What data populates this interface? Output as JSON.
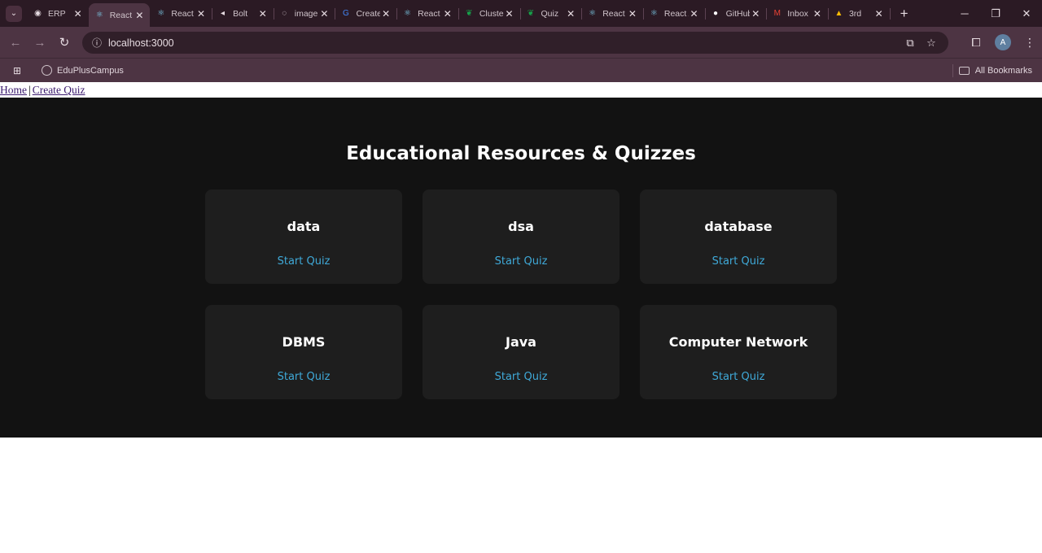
{
  "browser": {
    "tabs": [
      {
        "title": "ERP",
        "icon": "erp-icon"
      },
      {
        "title": "React App",
        "icon": "react-icon",
        "active": true
      },
      {
        "title": "React App",
        "icon": "react-icon"
      },
      {
        "title": "Bolt",
        "icon": "bolt-icon"
      },
      {
        "title": "image",
        "icon": "share-icon"
      },
      {
        "title": "Create",
        "icon": "google-icon"
      },
      {
        "title": "React App",
        "icon": "react-icon"
      },
      {
        "title": "Cluster",
        "icon": "mongodb-icon"
      },
      {
        "title": "Quiz",
        "icon": "mongodb-icon"
      },
      {
        "title": "React App",
        "icon": "react-icon"
      },
      {
        "title": "React App",
        "icon": "react-icon"
      },
      {
        "title": "GitHub",
        "icon": "github-icon"
      },
      {
        "title": "Inbox",
        "icon": "gmail-icon"
      },
      {
        "title": "3rd",
        "icon": "drive-icon"
      }
    ],
    "url": "localhost:3000",
    "avatar_letter": "A",
    "bookmarks": [
      {
        "label": "EduPlusCampus"
      }
    ],
    "all_bookmarks_label": "All Bookmarks"
  },
  "nav": {
    "home_label": "Home",
    "separator": "|",
    "create_label": "Create Quiz"
  },
  "main": {
    "heading": "Educational Resources & Quizzes",
    "start_label": "Start Quiz",
    "quizzes": [
      {
        "name": "data"
      },
      {
        "name": "dsa"
      },
      {
        "name": "database"
      },
      {
        "name": "DBMS"
      },
      {
        "name": "Java"
      },
      {
        "name": "Computer Network"
      }
    ]
  },
  "colors": {
    "background": "#121212",
    "card": "#1e1e1e",
    "link": "#3fa9d8"
  }
}
